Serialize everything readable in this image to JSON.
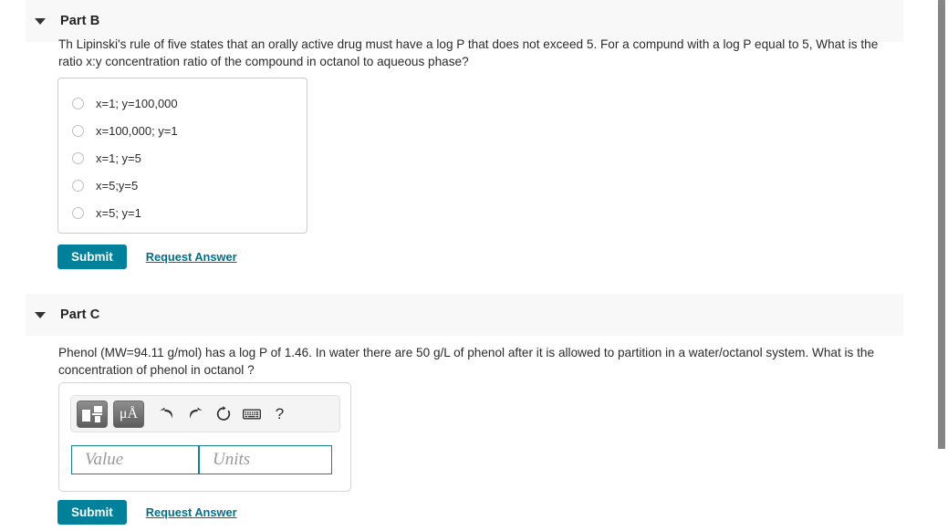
{
  "parts": [
    {
      "id": "part-b",
      "title": "Part B",
      "caret_icon": "caret-down-icon",
      "question": "Th Lipinski's rule of five states that an orally active drug must have a log P that does not exceed 5. For a compund with a log P equal to 5, What is the ratio x:y concentration ratio of the compound in octanol to aqueous phase?",
      "answer_type": "multiple-choice",
      "choices": [
        {
          "label": "x=1; y=100,000",
          "selected": false
        },
        {
          "label": "x=100,000; y=1",
          "selected": false
        },
        {
          "label": "x=1; y=5",
          "selected": false
        },
        {
          "label": "x=5;y=5",
          "selected": false
        },
        {
          "label": "x=5; y=1",
          "selected": false
        }
      ],
      "submit_label": "Submit",
      "request_answer_label": "Request Answer"
    },
    {
      "id": "part-c",
      "title": "Part C",
      "caret_icon": "caret-down-icon",
      "question": "Phenol (MW=94.11 g/mol) has a log P of 1.46. In water there are 50 g/L of phenol after it is allowed to partition in a water/octanol system. What is the concentration of phenol in octanol ?",
      "answer_type": "value-units",
      "toolbar": [
        {
          "name": "template-fraction-button",
          "icon": "template-fraction-icon",
          "label": ""
        },
        {
          "name": "units-symbol-button",
          "icon": "micro-angstrom-icon",
          "label": "μÅ"
        },
        {
          "name": "undo-button",
          "icon": "undo-arrow-icon",
          "label": ""
        },
        {
          "name": "redo-button",
          "icon": "redo-arrow-icon",
          "label": ""
        },
        {
          "name": "reset-button",
          "icon": "reset-circular-arrow-icon",
          "label": ""
        },
        {
          "name": "keyboard-button",
          "icon": "keyboard-icon",
          "label": ""
        },
        {
          "name": "help-button",
          "icon": "question-mark-icon",
          "label": "?"
        }
      ],
      "value_field": {
        "value": "",
        "placeholder": "Value"
      },
      "units_field": {
        "value": "",
        "placeholder": "Units"
      },
      "submit_label": "Submit",
      "request_answer_label": "Request Answer"
    }
  ],
  "colors": {
    "submit_button": "#00819b",
    "link": "#00708a",
    "field_border": "#1b7f94",
    "header_background": "#f8f8f8",
    "scrollbar_thumb": "#868686"
  }
}
